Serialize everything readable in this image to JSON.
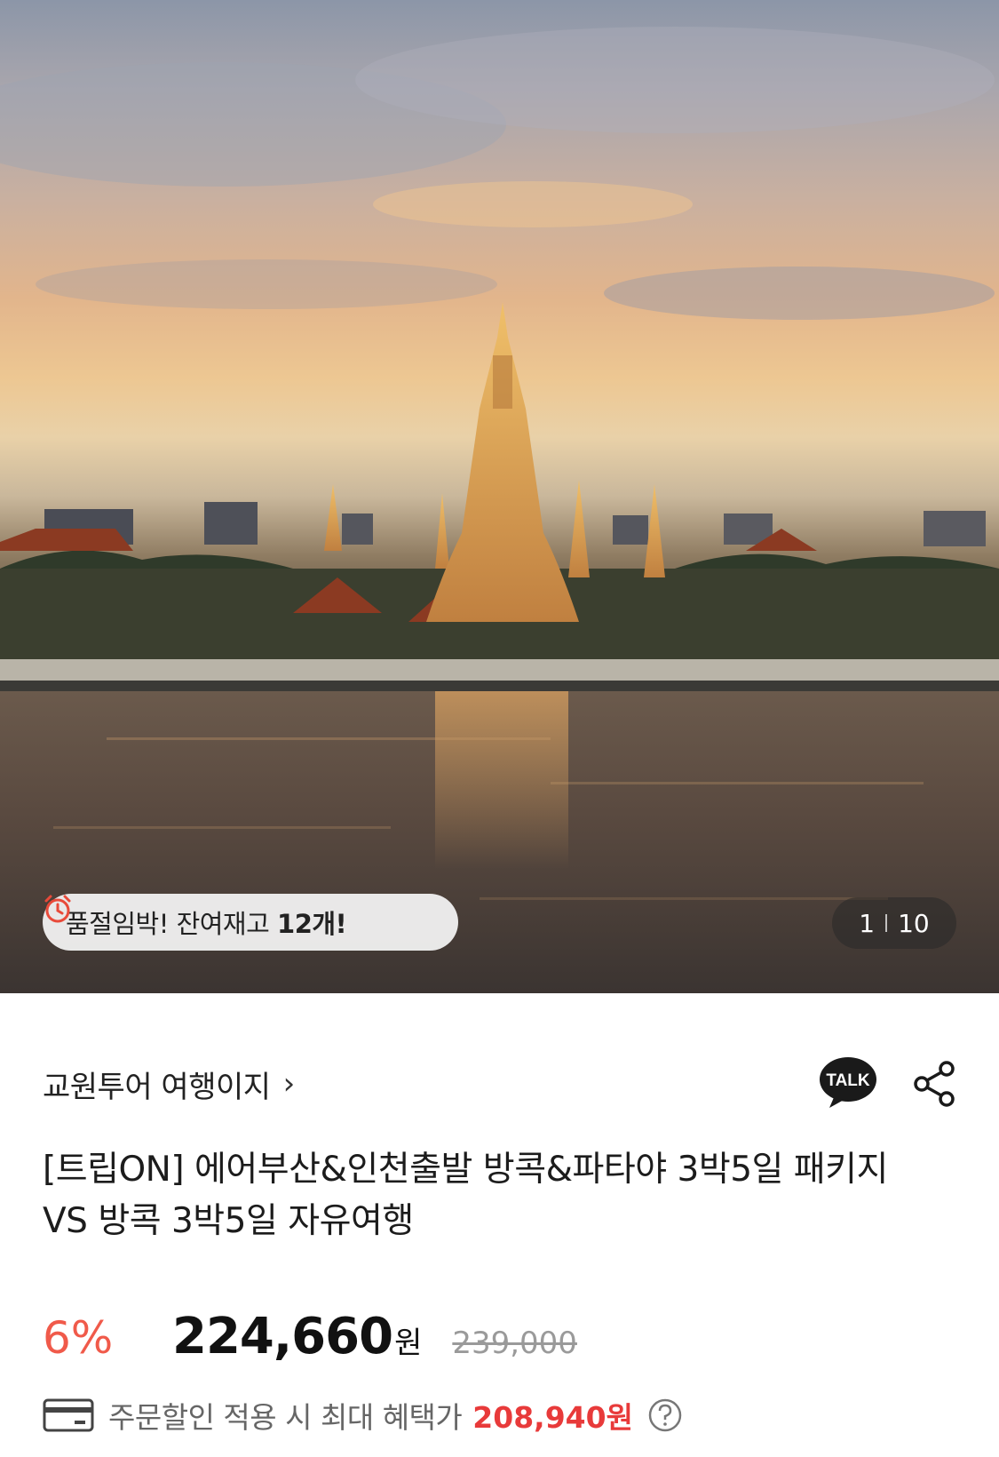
{
  "hero": {
    "image_alt": "방콕 왓 아룬 사원 석양 풍경",
    "stock_notice": {
      "icon": "alarm-clock-icon",
      "text": "품절임박! 잔여재고 ",
      "count": "12개!"
    },
    "counter": {
      "current": "1",
      "total": "10"
    }
  },
  "seller": {
    "name": "교원투어 여행이지",
    "chevron": "›"
  },
  "actions": {
    "talk_label": "TALK",
    "share_icon": "share-icon"
  },
  "product": {
    "title": "[트립ON] 에어부산&인천출발 방콕&파타야 3박5일 패키지 VS 방콕 3박5일 자유여행"
  },
  "pricing": {
    "discount": "6%",
    "price": "224,660",
    "currency": "원",
    "original_price": "239,000"
  },
  "benefit": {
    "icon": "card-icon",
    "text": "주문할인 적용 시 최대 혜택가",
    "amount": "208,940원",
    "help_icon": "question-circle-icon"
  },
  "colors": {
    "discount": "#f05a4a",
    "benefit_amount": "#e83a3a",
    "talk_bubble": "#1a1a1a"
  }
}
